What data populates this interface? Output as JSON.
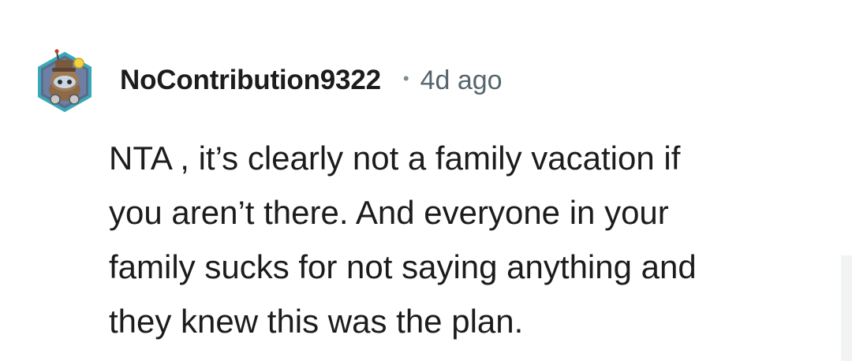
{
  "comment": {
    "author": {
      "username": "NoContribution9322",
      "avatar_icon": "snoo-avatar-icon"
    },
    "separator": "•",
    "timestamp": "4d ago",
    "body_lines": [
      "NTA , it’s clearly not a family vacation if",
      "you aren’t there. And everyone in your",
      "family sucks for not saying anything and",
      "they knew this was the plan."
    ]
  },
  "colors": {
    "text": "#1c1c1c",
    "meta": "#56656d",
    "avatar_border": "#3aa8b8"
  }
}
